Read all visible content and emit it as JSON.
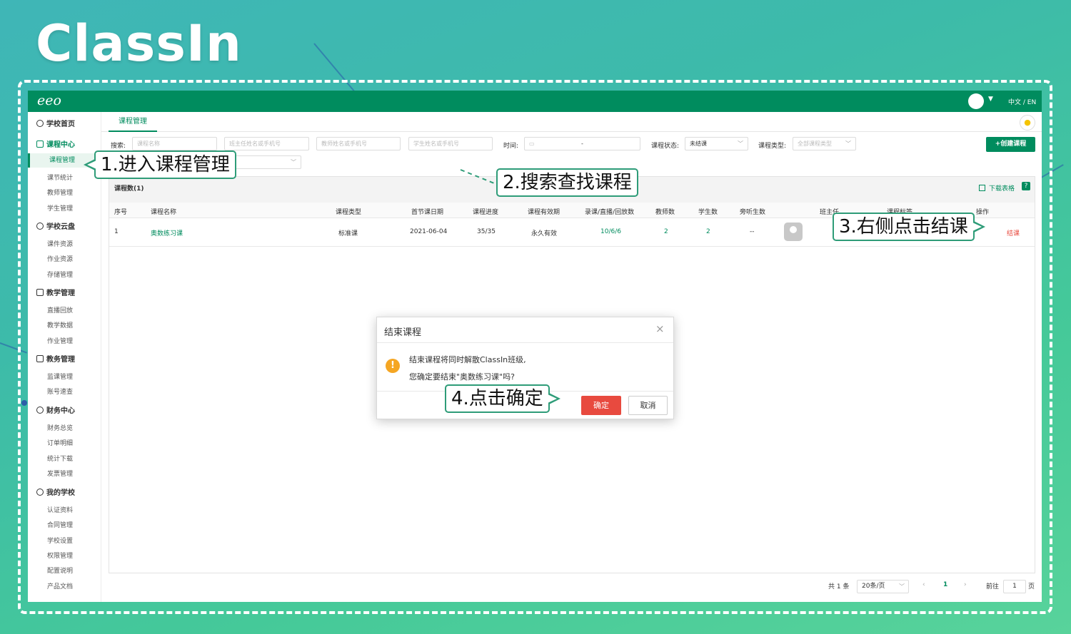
{
  "brand": {
    "logo_text": "ClassIn"
  },
  "app": {
    "logo": "eeo",
    "lang_switch": "中文 / EN"
  },
  "sidebar": {
    "sections": [
      {
        "label": "学校首页",
        "icon": "clock-icon",
        "items": []
      },
      {
        "label": "课程中心",
        "icon": "calendar-icon",
        "items": [
          "课程管理",
          "课节统计",
          "教师管理",
          "学生管理"
        ]
      },
      {
        "label": "学校云盘",
        "icon": "cloud-icon",
        "items": [
          "课件资源",
          "作业资源",
          "存储管理"
        ]
      },
      {
        "label": "教学管理",
        "icon": "board-icon",
        "items": [
          "直播回放",
          "教学数据",
          "作业管理"
        ]
      },
      {
        "label": "教务管理",
        "icon": "grid-icon",
        "items": [
          "监课管理",
          "账号速查"
        ]
      },
      {
        "label": "财务中心",
        "icon": "money-icon",
        "items": [
          "财务总览",
          "订单明细",
          "统计下载",
          "发票管理"
        ]
      },
      {
        "label": "我的学校",
        "icon": "gear-icon",
        "items": [
          "认证资料",
          "合同管理",
          "学校设置",
          "权限管理",
          "配置说明",
          "产品文档"
        ]
      }
    ]
  },
  "tabs": {
    "active": "课程管理"
  },
  "filters": {
    "search_label": "搜索:",
    "course_name_placeholder": "课程名称",
    "teacher_head_placeholder": "班主任姓名或手机号",
    "teacher_placeholder": "教师姓名或手机号",
    "student_placeholder": "学生姓名或手机号",
    "time_label": "时间:",
    "time_separator": "-",
    "status_label": "课程状态:",
    "status_value": "未结课",
    "type_label": "课程类型:",
    "type_placeholder": "全部课程类型",
    "create_button": "+创建课程"
  },
  "table": {
    "count_label": "课程数(1)",
    "download_label": "下载表格",
    "help": "?",
    "headers": [
      "序号",
      "课程名称",
      "课程类型",
      "首节课日期",
      "课程进度",
      "课程有效期",
      "录课/直播/回放数",
      "教师数",
      "学生数",
      "旁听生数",
      "班主任",
      "课程标签",
      "操作"
    ],
    "rows": [
      {
        "index": "1",
        "name": "奥数练习课",
        "type": "标准课",
        "first_date": "2021-06-04",
        "progress": "35/35",
        "validity": "永久有效",
        "record_live_replay": "10/6/6",
        "teachers": "2",
        "students": "2",
        "auditors": "--",
        "action": "结课"
      }
    ]
  },
  "pagination": {
    "total": "共 1 条",
    "page_size": "20条/页",
    "prev": "‹",
    "current": "1",
    "next": "›",
    "goto_label": "前往",
    "goto_value": "1",
    "page_suffix": "页"
  },
  "modal": {
    "title": "结束课程",
    "close": "×",
    "message_line1": "结束课程将同时解散ClassIn班级,",
    "message_line2": "您确定要结束\"奥数练习课\"吗?",
    "warning_glyph": "!",
    "ok": "确定",
    "cancel": "取消"
  },
  "callouts": {
    "step1": "1.进入课程管理",
    "step2": "2.搜索查找课程",
    "step3": "3.右侧点击结课",
    "step4": "4.点击确定"
  },
  "colors": {
    "primary": "#008c5e",
    "danger": "#e84a3f",
    "warning": "#f5a623"
  }
}
